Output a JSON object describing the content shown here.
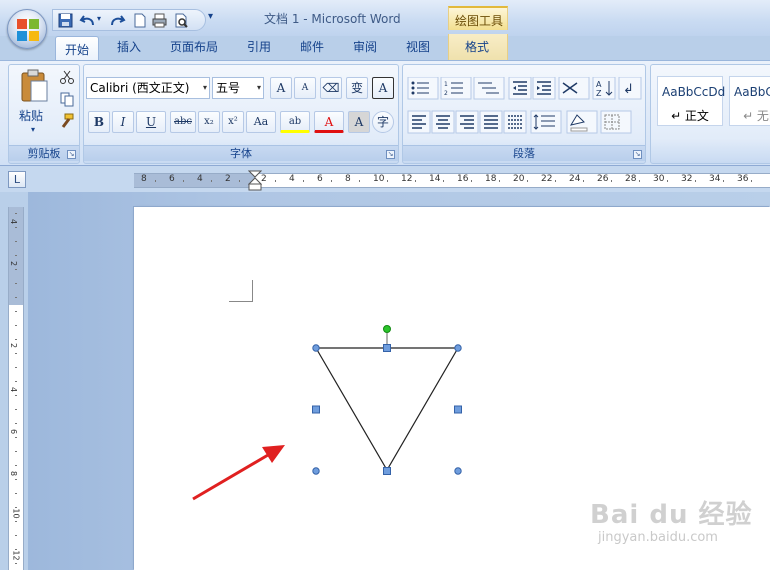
{
  "window": {
    "title": "文档 1 - Microsoft Word",
    "context_tools": "绘图工具"
  },
  "qat": {
    "more": "▾"
  },
  "tabs": {
    "home": "开始",
    "insert": "插入",
    "page_layout": "页面布局",
    "references": "引用",
    "mailings": "邮件",
    "review": "审阅",
    "view": "视图",
    "format": "格式"
  },
  "clipboard": {
    "paste_label": "粘贴",
    "group_label": "剪贴板"
  },
  "font": {
    "font_name": "Calibri (西文正文)",
    "font_size": "五号",
    "group_label": "字体",
    "grow": "A",
    "shrink": "A",
    "phonetic": "变",
    "border_char": "A",
    "bold": "B",
    "italic": "I",
    "underline": "U",
    "strike": "abc",
    "sub": "x₂",
    "sup": "x²",
    "case": "Aa",
    "highlight": "ab",
    "color": "A",
    "shade": "A",
    "enclose": "字"
  },
  "paragraph": {
    "group_label": "段落"
  },
  "styles": {
    "items": [
      {
        "sample": "AaBbCcDd",
        "name": "↵ 正文"
      },
      {
        "sample": "AaBbC",
        "name": "↵ 无间"
      }
    ]
  },
  "ruler": {
    "h_labels": [
      "8",
      "6",
      "4",
      "2",
      "2",
      "4",
      "6",
      "8",
      "10",
      "12",
      "14",
      "16",
      "18",
      "20",
      "22",
      "24",
      "26",
      "28",
      "30",
      "32",
      "34",
      "36"
    ],
    "v_labels": [
      "4",
      "2",
      "2",
      "4",
      "6",
      "8",
      "10",
      "12"
    ]
  },
  "watermark": {
    "logo": "Bai du 经验",
    "url": "jingyan.baidu.com"
  },
  "colors": {
    "accent": "#15428b",
    "arrow": "#e02020",
    "handle": "#3f74c8",
    "rotate_handle": "#22bb22"
  }
}
